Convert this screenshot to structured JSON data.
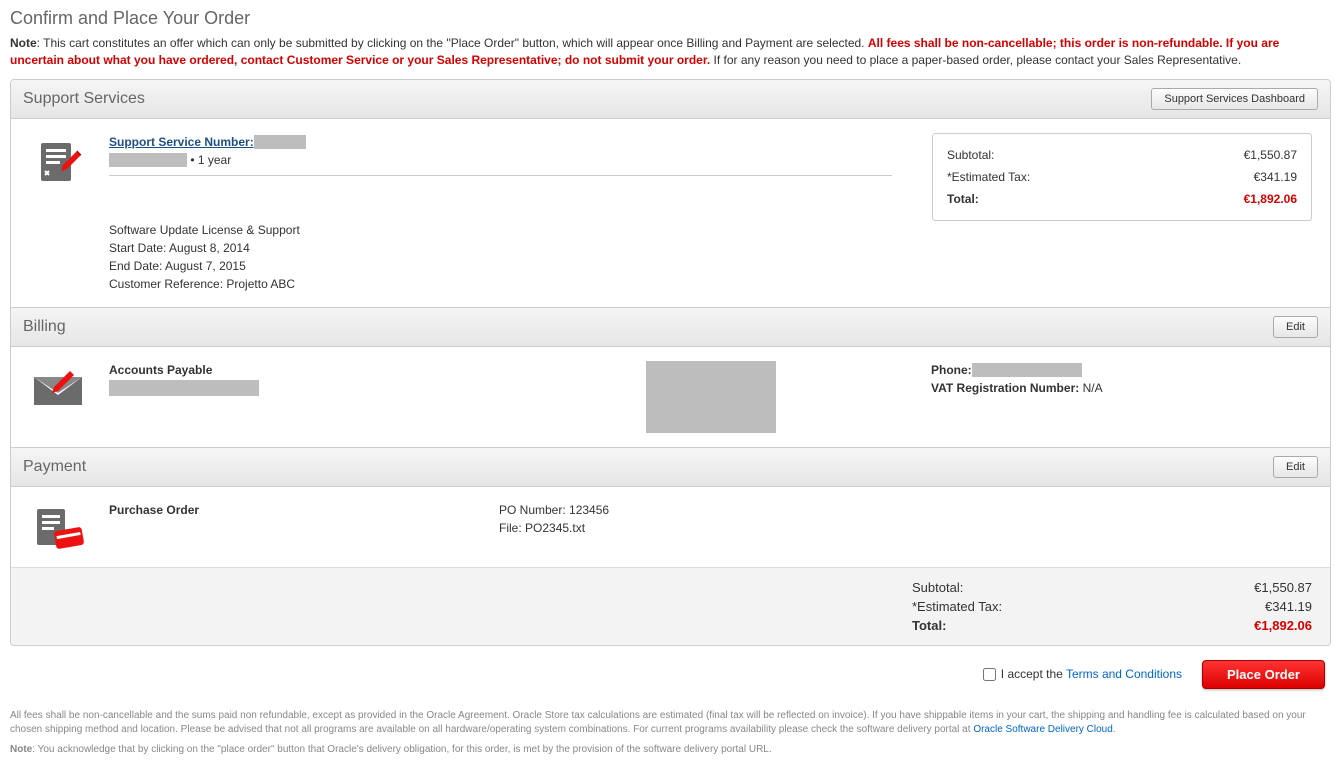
{
  "page_title": "Confirm and Place Your Order",
  "note": {
    "prefix": "Note",
    "part1": ": This cart constitutes an offer which can only be submitted by clicking on the \"Place Order\" button, which will appear once Billing and Payment are selected. ",
    "red": "All fees shall be non-cancellable; this order is non-refundable. If you are uncertain about what you have ordered, contact Customer Service or your Sales Representative; do not submit your order.",
    "part2": " If for any reason you need to place a paper-based order, please contact your Sales Representative."
  },
  "sections": {
    "support": {
      "title": "Support Services",
      "dashboard_btn": "Support Services Dashboard",
      "ssn_label": "Support Service Number:",
      "duration": "• 1 year",
      "line_item": "Software Update License & Support",
      "start": "Start Date: August 8, 2014",
      "end": "End Date: August 7, 2015",
      "custref": "Customer Reference: Projetto ABC",
      "summary": {
        "subtotal_label": "Subtotal:",
        "subtotal_value": "€1,550.87",
        "tax_label": "*Estimated Tax:",
        "tax_value": "€341.19",
        "total_label": "Total:",
        "total_value": "€1,892.06"
      }
    },
    "billing": {
      "title": "Billing",
      "edit_btn": "Edit",
      "accounts_payable": "Accounts Payable",
      "phone_label": "Phone:",
      "vat_label": "VAT Registration Number:",
      "vat_value": "N/A"
    },
    "payment": {
      "title": "Payment",
      "edit_btn": "Edit",
      "method": "Purchase Order",
      "po_number": "PO Number: 123456",
      "file": "File: PO2345.txt"
    }
  },
  "footer_summary": {
    "subtotal_label": "Subtotal:",
    "subtotal_value": "€1,550.87",
    "tax_label": "*Estimated Tax:",
    "tax_value": "€341.19",
    "total_label": "Total:",
    "total_value": "€1,892.06"
  },
  "order_bar": {
    "accept_text": "I accept the ",
    "terms_link": "Terms and Conditions",
    "place_order": "Place Order"
  },
  "fine_print": {
    "p1a": "All fees shall be non-cancellable and the sums paid non refundable, except as provided in the Oracle Agreement. Oracle Store tax calculations are estimated (final tax will be reflected on invoice). If you have shippable items in your cart, the shipping and handling fee is calculated based on your chosen shipping method and location. Please be advised that not all programs are available on all hardware/operating system combinations. For current programs availability please check the software delivery portal at ",
    "p1link": "Oracle Software Delivery Cloud",
    "p1b": ".",
    "p2prefix": "Note",
    "p2": ": You acknowledge that by clicking on the \"place order\" button that Oracle's delivery obligation, for this order, is met by the provision of the software delivery portal URL."
  }
}
